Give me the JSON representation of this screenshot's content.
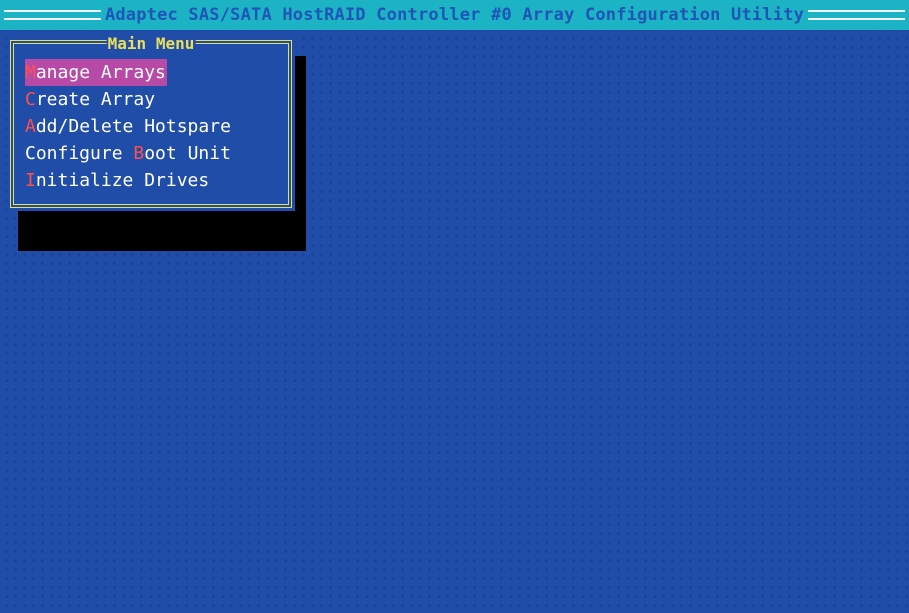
{
  "title_bar": {
    "text": "Adaptec SAS/SATA HostRAID Controller #0 Array Configuration Utility"
  },
  "main_menu": {
    "title": "Main Menu",
    "items": [
      {
        "hotkey": "M",
        "rest": "anage Arrays",
        "before": "",
        "selected": true
      },
      {
        "hotkey": "C",
        "rest": "reate Array",
        "before": "",
        "selected": false
      },
      {
        "hotkey": "A",
        "rest": "dd/Delete Hotspare",
        "before": "",
        "selected": false
      },
      {
        "hotkey": "B",
        "rest": "oot Unit",
        "before": "Configure ",
        "selected": false
      },
      {
        "hotkey": "I",
        "rest": "nitialize Drives",
        "before": "",
        "selected": false
      }
    ]
  },
  "colors": {
    "screen_bg": "#1f4da8",
    "title_bar_bg": "#1cb3c4",
    "menu_border": "#e8df5a",
    "hotkey": "#ff4f4f",
    "selection_bg": "#b64aa6"
  }
}
